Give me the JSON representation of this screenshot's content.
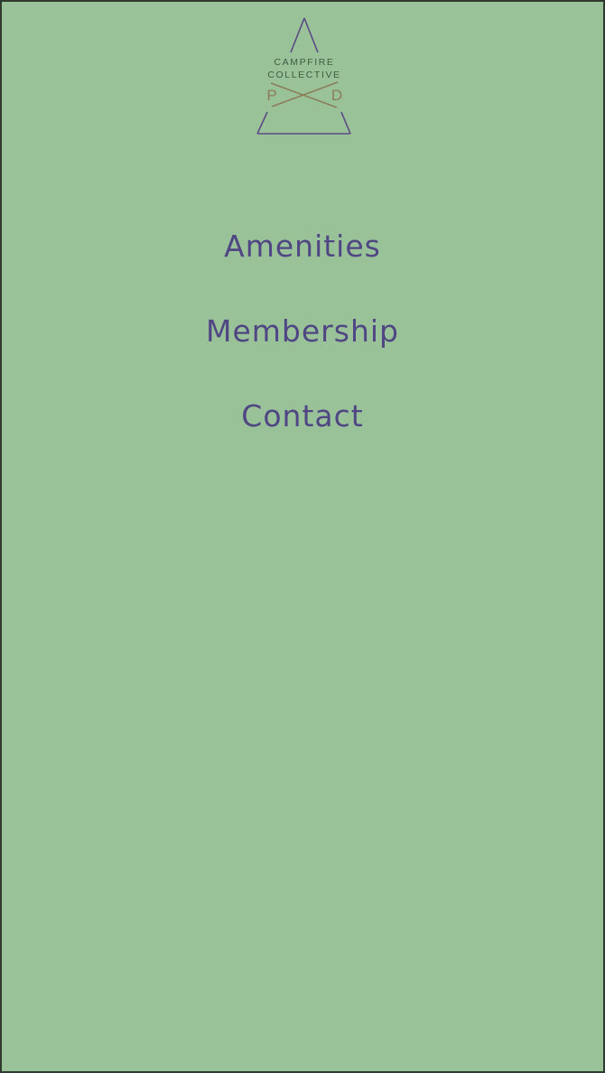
{
  "brand": {
    "line1": "CAMPFIRE",
    "line2": "COLLECTIVE",
    "letter_left": "P",
    "letter_right": "D"
  },
  "nav": {
    "items": [
      {
        "label": "Amenities"
      },
      {
        "label": "Membership"
      },
      {
        "label": "Contact"
      }
    ]
  },
  "colors": {
    "background": "#9ac299",
    "nav_text": "#4f4683",
    "logo_lines": "#5a4a86",
    "logo_cross": "#8b7d5a"
  }
}
